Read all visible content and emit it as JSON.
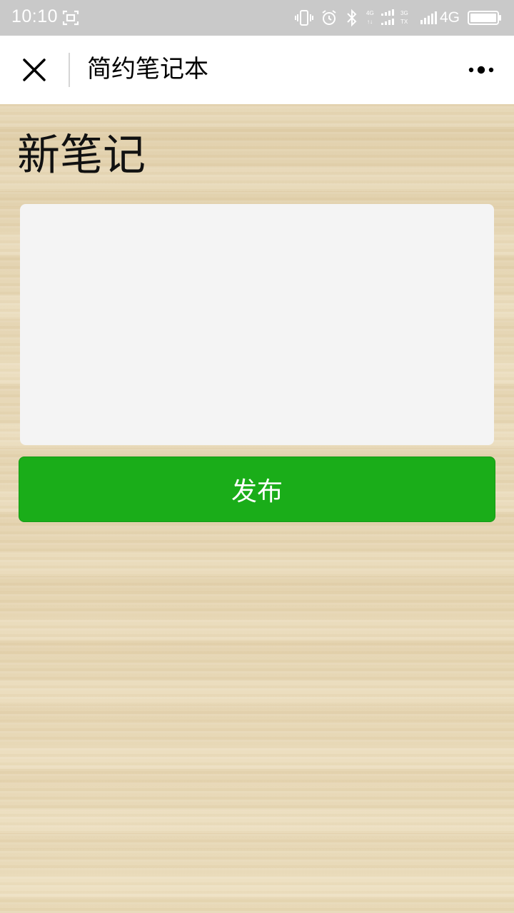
{
  "status_bar": {
    "time": "10:10",
    "network_label": "4G",
    "icons": [
      "screenshot-icon",
      "vibrate-icon",
      "alarm-icon",
      "bluetooth-icon",
      "dual-signal-icon",
      "signal-icon",
      "battery-icon"
    ],
    "mini_label_1_top": "4G",
    "mini_label_1_bottom": "↑↓",
    "mini_label_2_top": "3G",
    "mini_label_2_bottom": "TX"
  },
  "nav": {
    "title": "简约笔记本",
    "close_icon": "close-icon",
    "more_icon": "more-icon"
  },
  "main": {
    "heading": "新笔记",
    "note_value": "",
    "note_placeholder": "",
    "publish_label": "发布"
  },
  "colors": {
    "status_bar_bg": "#c9c9c9",
    "nav_bg": "#ffffff",
    "primary_button": "#1aad19",
    "textarea_bg": "#f4f4f4",
    "page_bg": "#e6d8b6"
  }
}
